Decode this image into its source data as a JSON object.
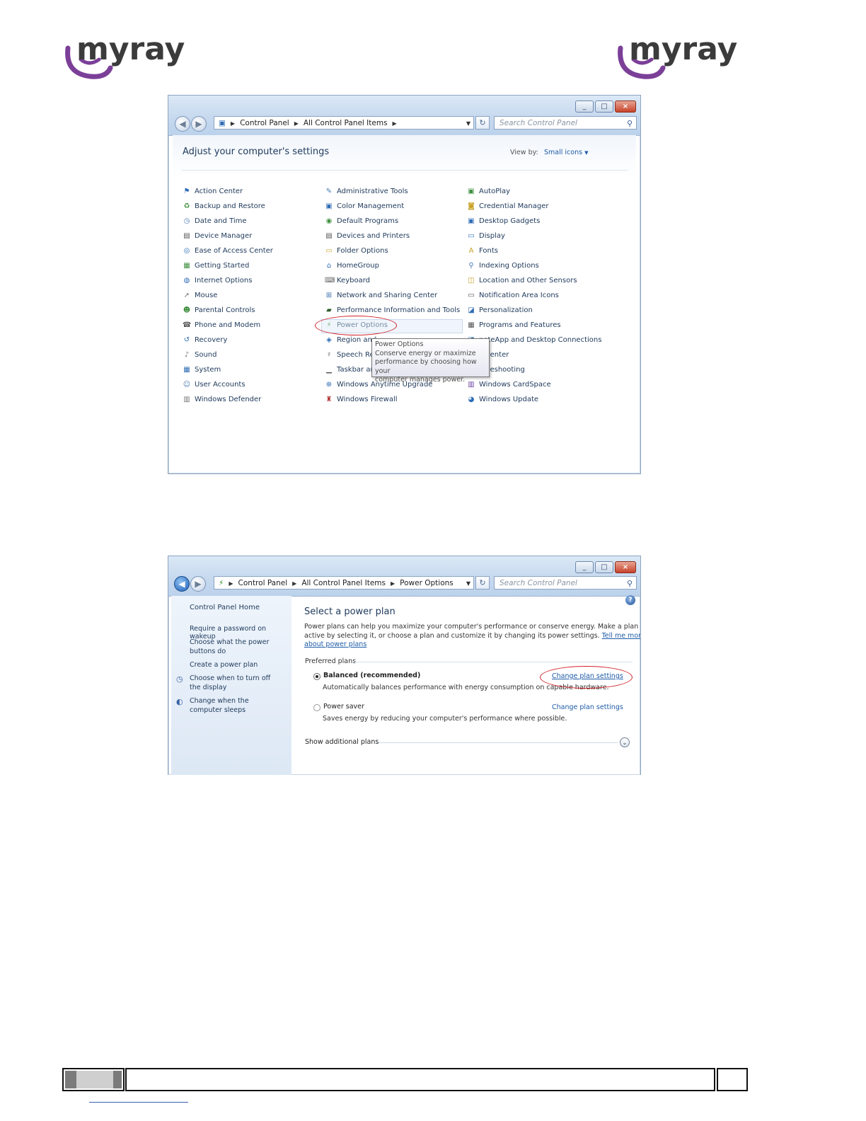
{
  "logo": {
    "text": "myray"
  },
  "window1": {
    "breadcrumb": [
      "Control Panel",
      "All Control Panel Items"
    ],
    "search_placeholder": "Search Control Panel",
    "title": "Adjust your computer's settings",
    "view_by_label": "View by:",
    "view_by_value": "Small icons",
    "columns": [
      [
        "Action Center",
        "Backup and Restore",
        "Date and Time",
        "Device Manager",
        "Ease of Access Center",
        "Getting Started",
        "Internet Options",
        "Mouse",
        "Parental Controls",
        "Phone and Modem",
        "Recovery",
        "Sound",
        "System",
        "User Accounts",
        "Windows Defender"
      ],
      [
        "Administrative Tools",
        "Color Management",
        "Default Programs",
        "Devices and Printers",
        "Folder Options",
        "HomeGroup",
        "Keyboard",
        "Network and Sharing Center",
        "Performance Information and Tools",
        "Power Options",
        "Region and Language",
        "Speech Recognition",
        "Taskbar and Start Menu",
        "Windows Anytime Upgrade",
        "Windows Firewall"
      ],
      [
        "AutoPlay",
        "Credential Manager",
        "Desktop Gadgets",
        "Display",
        "Fonts",
        "Indexing Options",
        "Location and Other Sensors",
        "Notification Area Icons",
        "Personalization",
        "Programs and Features",
        "RemoteApp and Desktop Connections",
        "Sync Center",
        "Troubleshooting",
        "Windows CardSpace",
        "Windows Update"
      ]
    ],
    "visible_labels": [
      [
        "Action Center",
        "Backup and Restore",
        "Date and Time",
        "Device Manager",
        "Ease of Access Center",
        "Getting Started",
        "Internet Options",
        "Mouse",
        "Parental Controls",
        "Phone and Modem",
        "Recovery",
        "Sound",
        "System",
        "User Accounts",
        "Windows Defender"
      ],
      [
        "Administrative Tools",
        "Color Management",
        "Default Programs",
        "Devices and Printers",
        "Folder Options",
        "HomeGroup",
        "Keyboard",
        "Network and Sharing Center",
        "Performance Information and Tools",
        "Power Options",
        "Region and",
        "Speech Re",
        "Taskbar ar",
        "Windows Anytime Upgrade",
        "Windows Firewall"
      ],
      [
        "AutoPlay",
        "Credential Manager",
        "Desktop Gadgets",
        "Display",
        "Fonts",
        "Indexing Options",
        "Location and Other Sensors",
        "Notification Area Icons",
        "Personalization",
        "Programs and Features",
        "noteApp and Desktop Connections",
        "c Center",
        "ubleshooting",
        "Windows CardSpace",
        "Windows Update"
      ]
    ],
    "tooltip": {
      "title": "Power Options",
      "lines": [
        "Conserve energy or maximize",
        "performance by choosing how your",
        "computer manages power."
      ]
    }
  },
  "window2": {
    "breadcrumb": [
      "Control Panel",
      "All Control Panel Items",
      "Power Options"
    ],
    "search_placeholder": "Search Control Panel",
    "sidebar": {
      "home": "Control Panel Home",
      "links": [
        "Require a password on wakeup",
        "Choose what the power buttons do",
        "Create a power plan",
        "Choose when to turn off the display",
        "Change when the computer sleeps"
      ]
    },
    "heading": "Select a power plan",
    "intro_line1": "Power plans can help you maximize your computer's performance or conserve energy. Make a plan",
    "intro_line2": "active by selecting it, or choose a plan and customize it by changing its power settings.",
    "intro_link_part1": "Tell me more",
    "intro_link_part2": "about power plans",
    "preferred_label": "Preferred plans",
    "plans": [
      {
        "name": "Balanced (recommended)",
        "selected": true,
        "description": "Automatically balances performance with energy consumption on capable hardware.",
        "link": "Change plan settings"
      },
      {
        "name": "Power saver",
        "selected": false,
        "description": "Saves energy by reducing your computer's performance where possible.",
        "link": "Change plan settings"
      }
    ],
    "show_more": "Show additional plans"
  },
  "colors": {
    "link": "#1e5ba8",
    "highlight": "#d2232a",
    "logo_purple": "#7b3f98"
  }
}
